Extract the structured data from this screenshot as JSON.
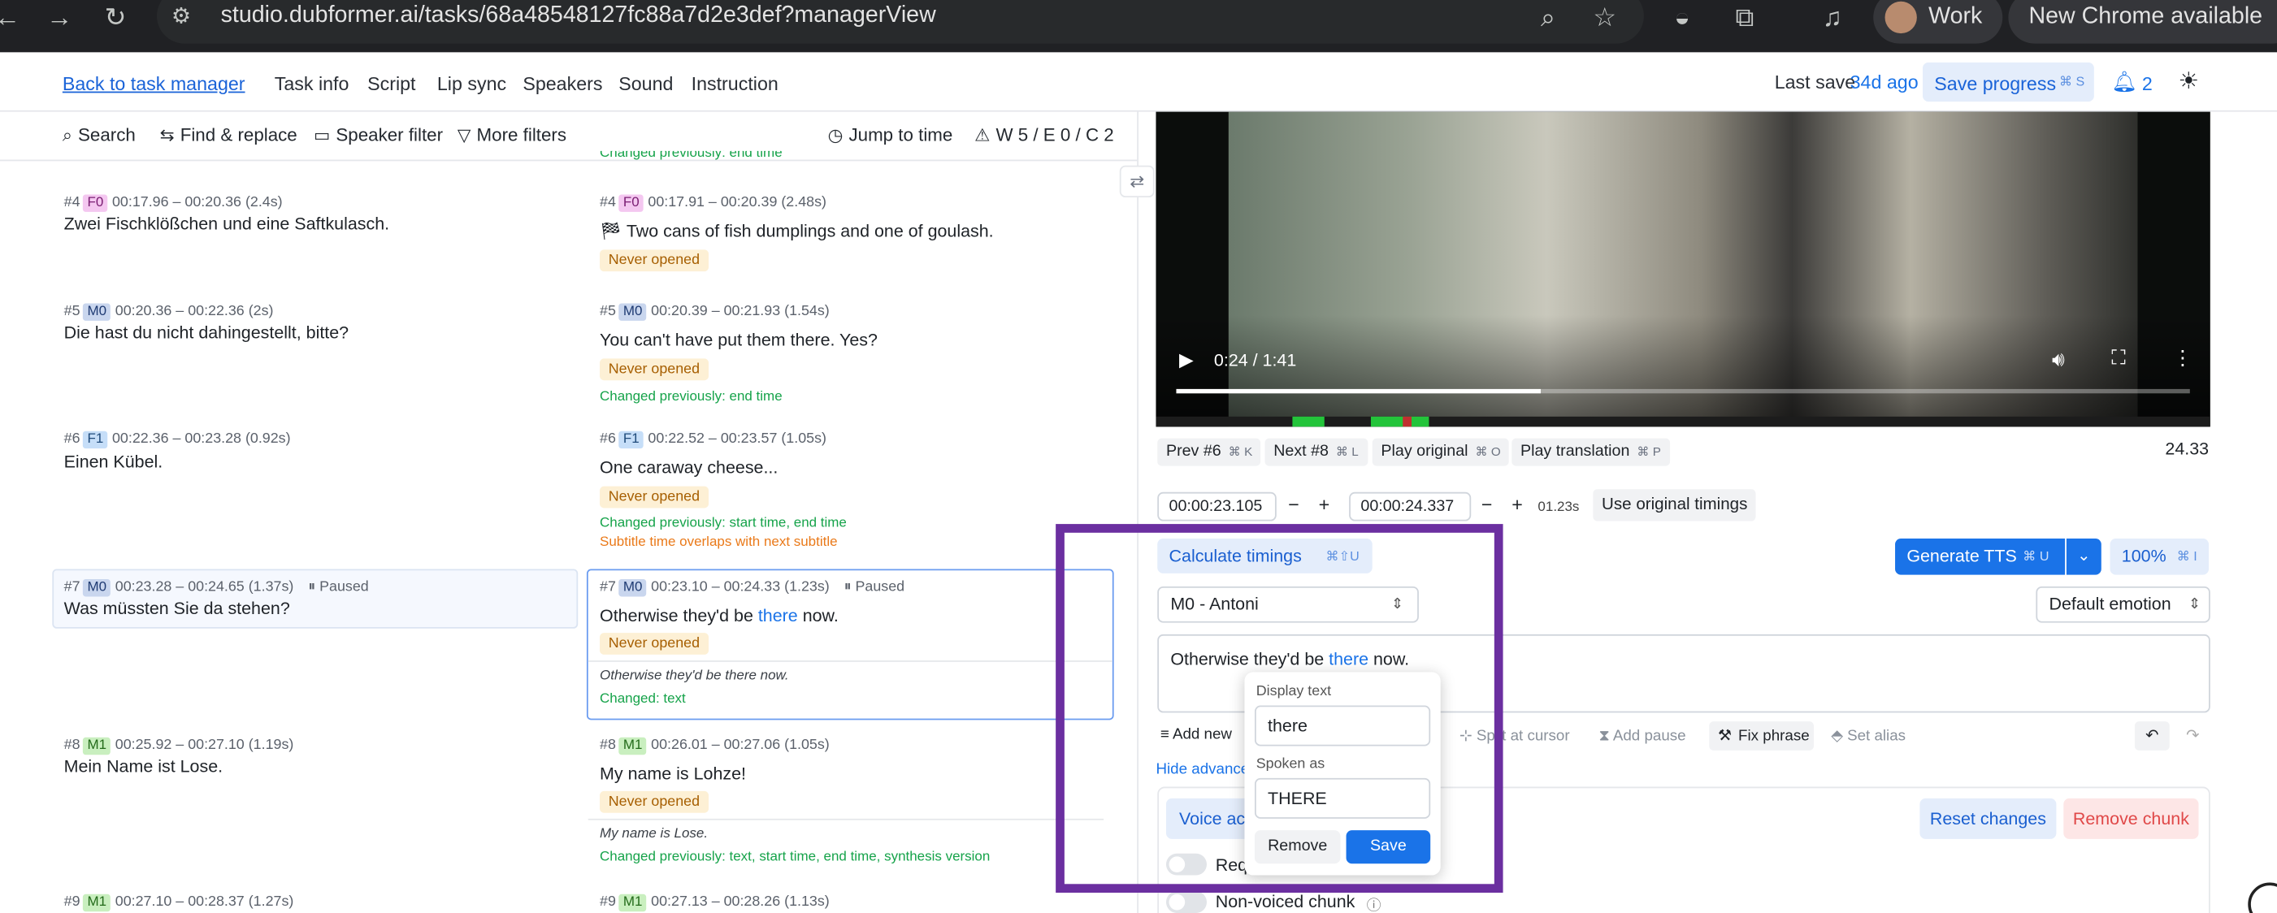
{
  "browser": {
    "url": "studio.dubformer.ai/tasks/68a48548127fc88a7d2e3def?managerView",
    "profile": "Work",
    "update": "New Chrome available"
  },
  "header": {
    "back": "Back to task manager",
    "tabs": [
      "Task info",
      "Script",
      "Lip sync",
      "Speakers",
      "Sound",
      "Instruction"
    ],
    "active_tab": "Script",
    "last_save_label": "Last save",
    "last_save_value": "34d ago",
    "save_btn": "Save progress",
    "save_kbd": "⌘ S",
    "notif_count": "2"
  },
  "toolbar": {
    "search": "Search",
    "find_replace": "Find & replace",
    "speaker_filter": "Speaker filter",
    "more_filters": "More filters",
    "jump": "Jump to time",
    "warnings": "W 5 / E 0 / C 2",
    "top_clipped": "Changed previously: end time"
  },
  "rows": {
    "r4": {
      "num": "#4",
      "spk": "F0",
      "ot": "00:17.96 – 00:20.36 (2.4s)",
      "orig": "Zwei Fischklößchen und eine Saftkulasch.",
      "tt": "00:17.91 – 00:20.39 (2.48s)",
      "trans": "Two cans of fish dumplings and one of goulash.",
      "badge": "Never opened"
    },
    "r5": {
      "num": "#5",
      "spk": "M0",
      "ot": "00:20.36 – 00:22.36 (2s)",
      "orig": "Die hast du nicht dahingestellt, bitte?",
      "tt": "00:20.39 – 00:21.93 (1.54s)",
      "trans": "You can't have put them there. Yes?",
      "badge": "Never opened",
      "chg": "Changed previously: end time"
    },
    "r6": {
      "num": "#6",
      "spk": "F1",
      "ot": "00:22.36 – 00:23.28 (0.92s)",
      "orig": "Einen Kübel.",
      "tt": "00:22.52 – 00:23.57 (1.05s)",
      "trans": "One caraway cheese...",
      "badge": "Never opened",
      "chg": "Changed previously: start time, end time",
      "warn": "Subtitle time overlaps with next subtitle"
    },
    "r7": {
      "num": "#7",
      "spk": "M0",
      "ot": "00:23.28 – 00:24.65 (1.37s)",
      "paused": "Paused",
      "orig": "Was müssten Sie da stehen?",
      "tt": "00:23.10 – 00:24.33 (1.23s)",
      "trans_pre": "Otherwise they'd be ",
      "trans_word": "there",
      "trans_post": " now.",
      "badge": "Never opened",
      "ital": "Otherwise they'd be there now.",
      "chg": "Changed: text"
    },
    "r8": {
      "num": "#8",
      "spk": "M1",
      "ot": "00:25.92 – 00:27.10 (1.19s)",
      "orig": "Mein Name ist Lose.",
      "tt": "00:26.01 – 00:27.06 (1.05s)",
      "trans": "My name is Lohze!",
      "badge": "Never opened",
      "ital": "My name is Lose.",
      "chg": "Changed previously: text, start time, end time, synthesis version"
    },
    "r9": {
      "num": "#9",
      "spk": "M1",
      "ot": "00:27.10 – 00:28.37 (1.27s)",
      "tt": "00:27.13 – 00:28.26 (1.13s)"
    }
  },
  "player": {
    "time": "0:24 / 1:41",
    "progress": 0.36
  },
  "controls": {
    "prev": "Prev #6",
    "prev_kbd": "⌘ K",
    "next": "Next #8",
    "next_kbd": "⌘ L",
    "play_orig": "Play original",
    "play_orig_kbd": "⌘ O",
    "play_trans": "Play translation",
    "play_trans_kbd": "⌘ P",
    "pos": "24.33",
    "start": "00:00:23.105",
    "end": "00:00:24.337",
    "dur": "01.23s",
    "use_orig": "Use original timings",
    "calc": "Calculate timings",
    "calc_kbd": "⌘⇧U",
    "gen": "Generate TTS",
    "gen_kbd": "⌘ U",
    "speed": "100%",
    "speed_kbd": "⌘ I",
    "voice": "M0 - Antoni",
    "emotion": "Default emotion",
    "text_pre": "Otherwise they'd be ",
    "text_word": "there",
    "text_post": " now.",
    "add_new": "Add new",
    "split": "Split at cursor",
    "add_pause": "Add pause",
    "fix_phrase": "Fix phrase",
    "set_alias": "Set alias",
    "hide_adv": "Hide advance",
    "voice_act": "Voice act",
    "reset": "Reset changes",
    "remove_chunk": "Remove chunk",
    "req": "Req",
    "non_voiced": "Non-voiced chunk"
  },
  "popover": {
    "display_label": "Display text",
    "display_value": "there",
    "spoken_label": "Spoken as",
    "spoken_value": "THERE",
    "remove": "Remove",
    "save": "Save"
  },
  "colors": {
    "accent": "#1a73e8",
    "highlight_box": "#6b2fa0",
    "changed": "#16a34a",
    "warning": "#ea7a1a"
  }
}
